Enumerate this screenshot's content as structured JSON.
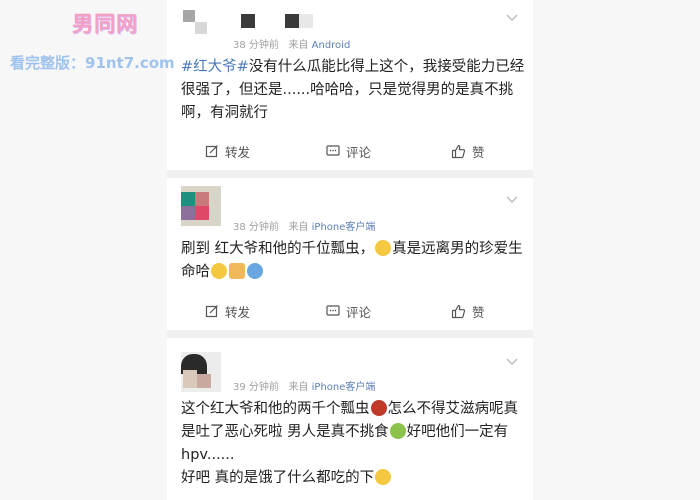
{
  "watermark": {
    "logo": "男同网",
    "url": "看完整版：91nt7.com"
  },
  "posts": [
    {
      "time": "38 分钟前",
      "from": "来自",
      "source": "Android",
      "hashtag": "#红大爷#",
      "text": "没有什么瓜能比得上这个，我接受能力已经很强了，但还是......哈哈哈，只是觉得男的是真不挑啊，有洞就行"
    },
    {
      "time": "38 分钟前",
      "from": "来自",
      "source": "iPhone客户端",
      "text_a": "刷到 红大爷和他的千位瓢虫，",
      "text_b": "真是远离男的珍爱生命哈"
    },
    {
      "time": "39 分钟前",
      "from": "来自",
      "source": "iPhone客户端",
      "text_a": "这个红大爷和他的两千个瓢虫",
      "text_b": "怎么不得艾滋病呢真是吐了恶心死啦 男人是真不挑食",
      "text_c": "好吧他们一定有 hpv......",
      "text_d": "好吧 真的是饿了什么都吃的下"
    }
  ],
  "actions": {
    "repost": "转发",
    "comment": "评论",
    "like": "赞"
  },
  "icons": {
    "chevron": "chevron-down-icon",
    "repost": "repost-icon",
    "comment": "comment-icon",
    "like": "thumbs-up-icon",
    "emoji_smile": "smile-emoji",
    "emoji_pray": "pray-emoji",
    "emoji_ladybug": "ladybug-emoji",
    "emoji_vomit": "vomit-emoji",
    "emoji_laugh": "laugh-emoji"
  },
  "colors": {
    "link": "#4a7ab8",
    "meta": "#a0a0a0",
    "text": "#222222",
    "watermark_logo": "#f2a0c4",
    "watermark_url": "#9fc3ee"
  }
}
